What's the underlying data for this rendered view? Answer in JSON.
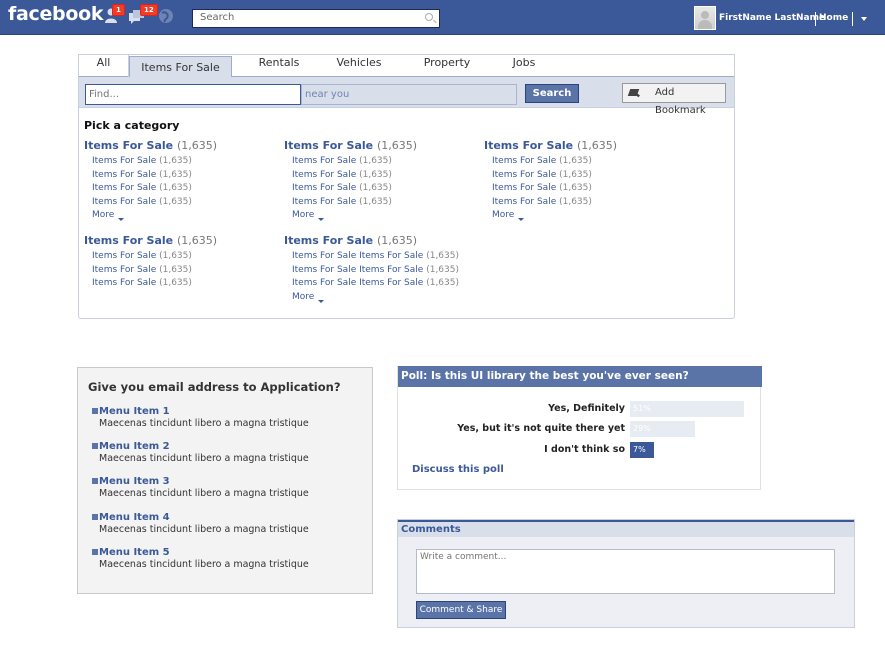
{
  "topbar": {
    "logo": "facebook",
    "friend_requests_badge": "1",
    "messages_badge": "12",
    "search_placeholder": "Search",
    "username": "FirstName LastName",
    "home_label": "Home",
    "colors": {
      "bar": "#3b5998",
      "badge": "#f03d25"
    }
  },
  "market": {
    "tabs": [
      {
        "label": "All"
      },
      {
        "label": "Items For Sale",
        "active": true
      },
      {
        "label": "Rentals"
      },
      {
        "label": "Vehicles"
      },
      {
        "label": "Property"
      },
      {
        "label": "Jobs"
      }
    ],
    "find_placeholder": "Find...",
    "near_value": "near you",
    "search_label": "Search",
    "bookmark_label": "Add Bookmark",
    "pick_label": "Pick a category",
    "more_label": "More",
    "categories": [
      {
        "title": "Items For Sale",
        "count": "(1,635)",
        "items": [
          {
            "label": "Items For Sale",
            "count": "(1,635)"
          },
          {
            "label": "Items For Sale",
            "count": "(1,635)"
          },
          {
            "label": "Items For Sale",
            "count": "(1,635)"
          },
          {
            "label": "Items For Sale",
            "count": "(1,635)"
          }
        ],
        "more": true
      },
      {
        "title": "Items For Sale",
        "count": "(1,635)",
        "items": [
          {
            "label": "Items For Sale",
            "count": "(1,635)"
          },
          {
            "label": "Items For Sale",
            "count": "(1,635)"
          },
          {
            "label": "Items For Sale",
            "count": "(1,635)"
          },
          {
            "label": "Items For Sale",
            "count": "(1,635)"
          }
        ],
        "more": true
      },
      {
        "title": "Items For Sale",
        "count": "(1,635)",
        "items": [
          {
            "label": "Items For Sale",
            "count": "(1,635)"
          },
          {
            "label": "Items For Sale",
            "count": "(1,635)"
          },
          {
            "label": "Items For Sale",
            "count": "(1,635)"
          },
          {
            "label": "Items For Sale",
            "count": "(1,635)"
          }
        ],
        "more": true
      },
      {
        "title": "Items For Sale",
        "count": "(1,635)",
        "items": [
          {
            "label": "Items For Sale",
            "count": "(1,635)"
          },
          {
            "label": "Items For Sale",
            "count": "(1,635)"
          },
          {
            "label": "Items For Sale",
            "count": "(1,635)"
          }
        ],
        "more": false
      },
      {
        "title": "Items For Sale",
        "count": "(1,635)",
        "items": [
          {
            "label": "Items For Sale Items For Sale",
            "count": "(1,635)"
          },
          {
            "label": "Items For Sale Items For Sale",
            "count": "(1,635)"
          },
          {
            "label": "Items For Sale Items For Sale",
            "count": "(1,635)"
          }
        ],
        "more": true
      }
    ]
  },
  "email_panel": {
    "title": "Give you email address to Application?",
    "items": [
      {
        "label": "Menu Item 1",
        "desc": "Maecenas tincidunt libero a magna tristique"
      },
      {
        "label": "Menu Item 2",
        "desc": "Maecenas tincidunt libero a magna tristique"
      },
      {
        "label": "Menu Item 3",
        "desc": "Maecenas tincidunt libero a magna tristique"
      },
      {
        "label": "Menu Item 4",
        "desc": "Maecenas tincidunt libero a magna tristique"
      },
      {
        "label": "Menu Item 5",
        "desc": "Maecenas tincidunt libero a magna tristique"
      }
    ]
  },
  "poll": {
    "title": "Poll: Is this UI library the best you've ever seen?",
    "options": [
      {
        "label": "Yes, Definitely",
        "percent": 51,
        "display": "51%",
        "selected": false
      },
      {
        "label": "Yes, but it's not quite there yet",
        "percent": 29,
        "display": "29%",
        "selected": false
      },
      {
        "label": "I don't think so",
        "percent": 7,
        "display": "7%",
        "selected": true
      }
    ],
    "discuss_label": "Discuss this poll"
  },
  "comments": {
    "title": "Comments",
    "placeholder": "Write a comment...",
    "button_label": "Comment & Share"
  }
}
